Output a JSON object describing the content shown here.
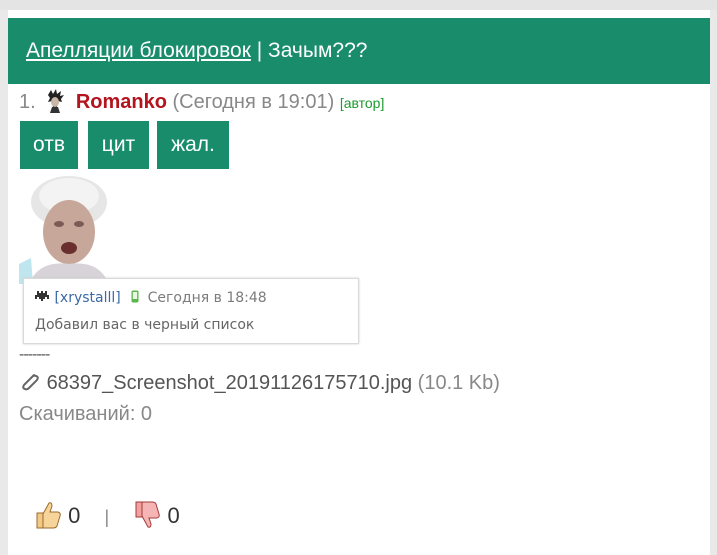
{
  "header": {
    "link_text": "Апелляции блокировок",
    "separator": " | ",
    "topic_title": "Зачым???"
  },
  "post": {
    "number": "1.",
    "author": "Romanko",
    "time": "(Сегодня в 19:01)",
    "role": "[автор]"
  },
  "actions": {
    "reply": "отв",
    "quote": "цит",
    "report": "жал."
  },
  "quote": {
    "user": "[xrystalll]",
    "time": "Сегодня в 18:48",
    "text": "Добавил вас в черный список"
  },
  "separator_line": "-------",
  "attachment": {
    "file_name": "68397_Screenshot_20191126175710.jpg",
    "file_size": "(10.1 Kb)",
    "downloads": "Скачиваний: 0"
  },
  "rating": {
    "likes": "0",
    "divider": "|",
    "dislikes": "0"
  },
  "colors": {
    "accent": "#198c6c",
    "author": "#b3141e",
    "role": "#1d9b2f"
  }
}
